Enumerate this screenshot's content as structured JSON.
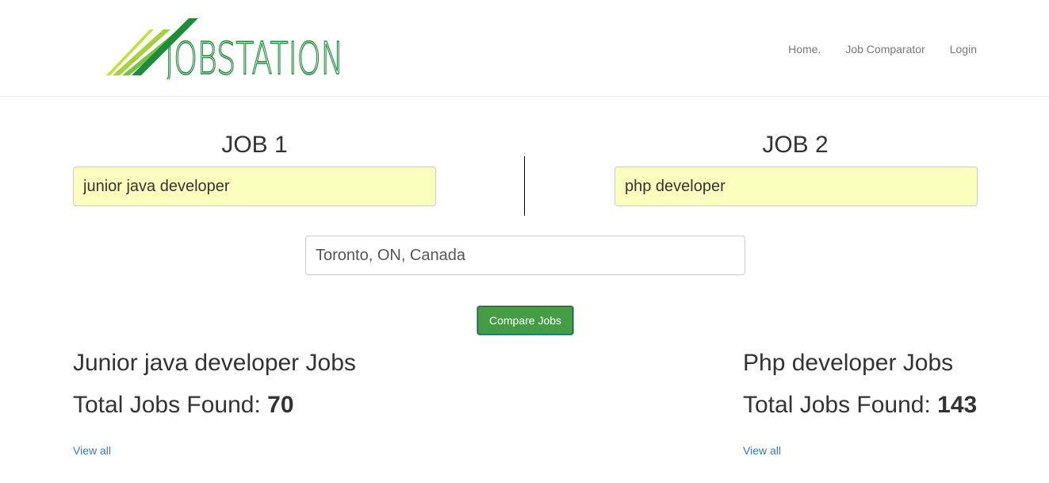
{
  "brand": {
    "logo_text": "JOBSTATION"
  },
  "nav": {
    "items": [
      {
        "label": "Home."
      },
      {
        "label": "Job Comparator"
      },
      {
        "label": "Login"
      }
    ]
  },
  "form": {
    "job1": {
      "title": "JOB 1",
      "value": "junior java developer"
    },
    "job2": {
      "title": "JOB 2",
      "value": "php developer"
    },
    "location": {
      "value": "Toronto, ON, Canada"
    },
    "submit_label": "Compare Jobs"
  },
  "results": {
    "job1": {
      "heading": "Junior java developer Jobs",
      "total_prefix": "Total Jobs Found:",
      "total": "70",
      "view_all": "View all"
    },
    "job2": {
      "heading": "Php developer Jobs",
      "total_prefix": "Total Jobs Found:",
      "total": "143",
      "view_all": "View all"
    }
  },
  "colors": {
    "logo_green_dark": "#1e8c3a",
    "logo_green_light": "#a6d13a",
    "button_green": "#449d44",
    "input_autofill": "#faffbd",
    "link_blue": "#337ab7"
  }
}
